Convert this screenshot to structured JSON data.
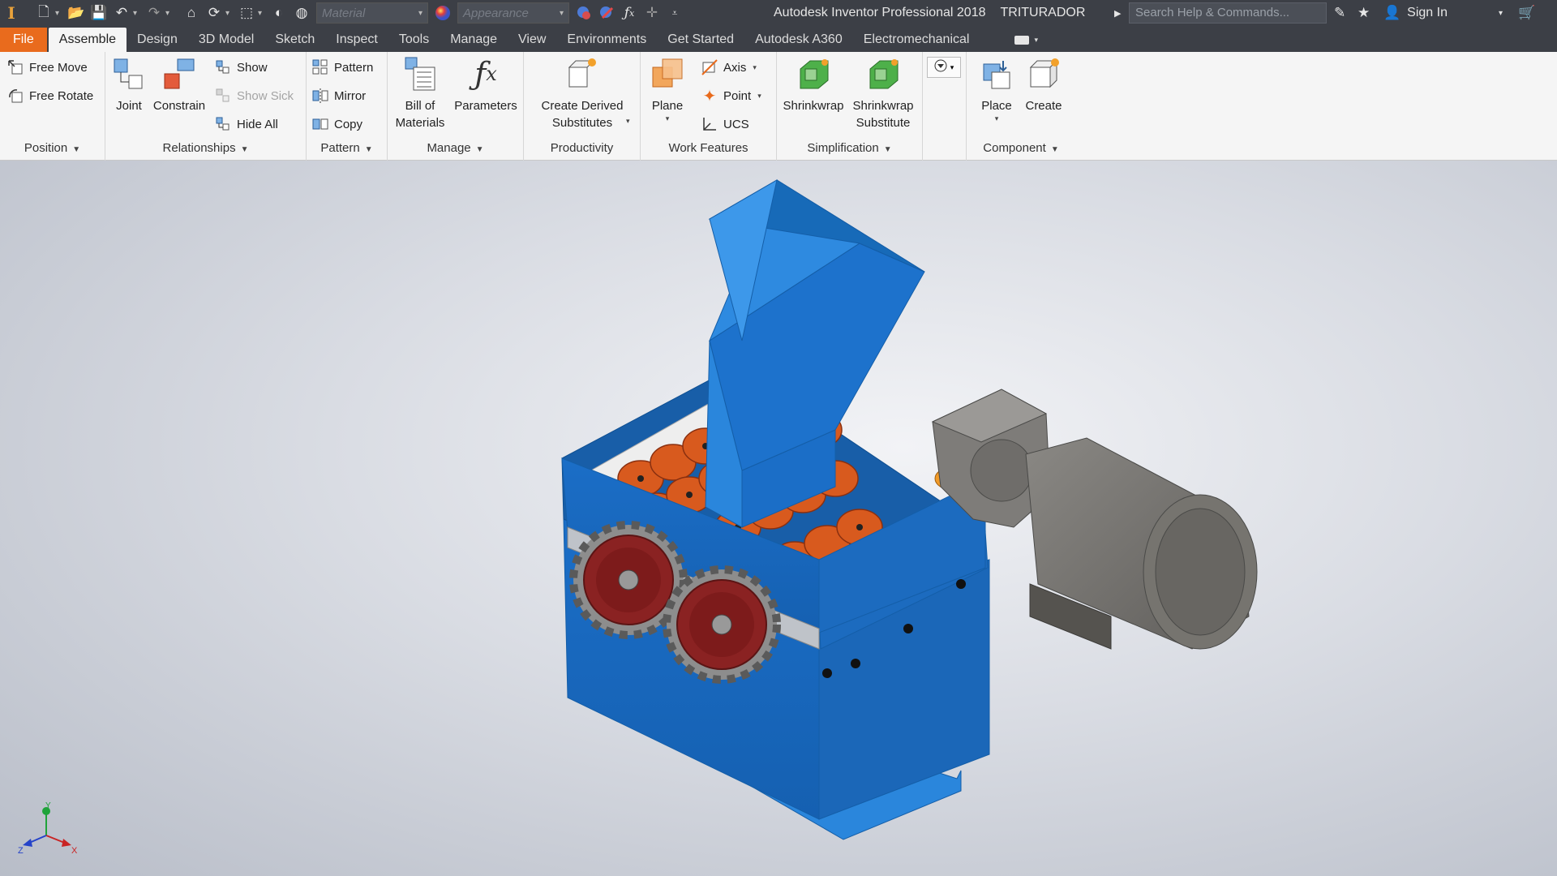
{
  "qat": {
    "material_placeholder": "Material",
    "appearance_placeholder": "Appearance"
  },
  "title": {
    "app": "Autodesk Inventor Professional 2018",
    "document": "TRITURADOR",
    "search_placeholder": "Search Help & Commands...",
    "sign_in": "Sign In"
  },
  "tabs": {
    "file": "File",
    "items": [
      "Assemble",
      "Design",
      "3D Model",
      "Sketch",
      "Inspect",
      "Tools",
      "Manage",
      "View",
      "Environments",
      "Get Started",
      "Autodesk A360",
      "Electromechanical"
    ],
    "active": "Assemble"
  },
  "ribbon": {
    "position": {
      "label": "Position",
      "free_move": "Free Move",
      "free_rotate": "Free Rotate"
    },
    "relationships": {
      "label": "Relationships",
      "joint": "Joint",
      "constrain": "Constrain",
      "show": "Show",
      "show_sick": "Show Sick",
      "hide_all": "Hide All"
    },
    "pattern": {
      "label": "Pattern",
      "pattern": "Pattern",
      "mirror": "Mirror",
      "copy": "Copy"
    },
    "manage": {
      "label": "Manage",
      "bom_line1": "Bill of",
      "bom_line2": "Materials",
      "parameters": "Parameters"
    },
    "productivity": {
      "label": "Productivity",
      "cds_line1": "Create Derived",
      "cds_line2": "Substitutes"
    },
    "work_features": {
      "label": "Work Features",
      "plane": "Plane",
      "axis": "Axis",
      "point": "Point",
      "ucs": "UCS"
    },
    "simplification": {
      "label": "Simplification",
      "shrinkwrap": "Shrinkwrap",
      "sws_line1": "Shrinkwrap",
      "sws_line2": "Substitute"
    },
    "component": {
      "label": "Component",
      "place": "Place",
      "create": "Create"
    }
  },
  "triad": {
    "x": "X",
    "y": "Y",
    "z": "Z"
  },
  "colors": {
    "titlebar": "#3c3f46",
    "file_tab": "#e96b1d",
    "ribbon": "#f5f5f5",
    "housing_blue": "#1f78cc",
    "cutter_orange": "#d8571c",
    "motor_gray": "#7a7874"
  }
}
